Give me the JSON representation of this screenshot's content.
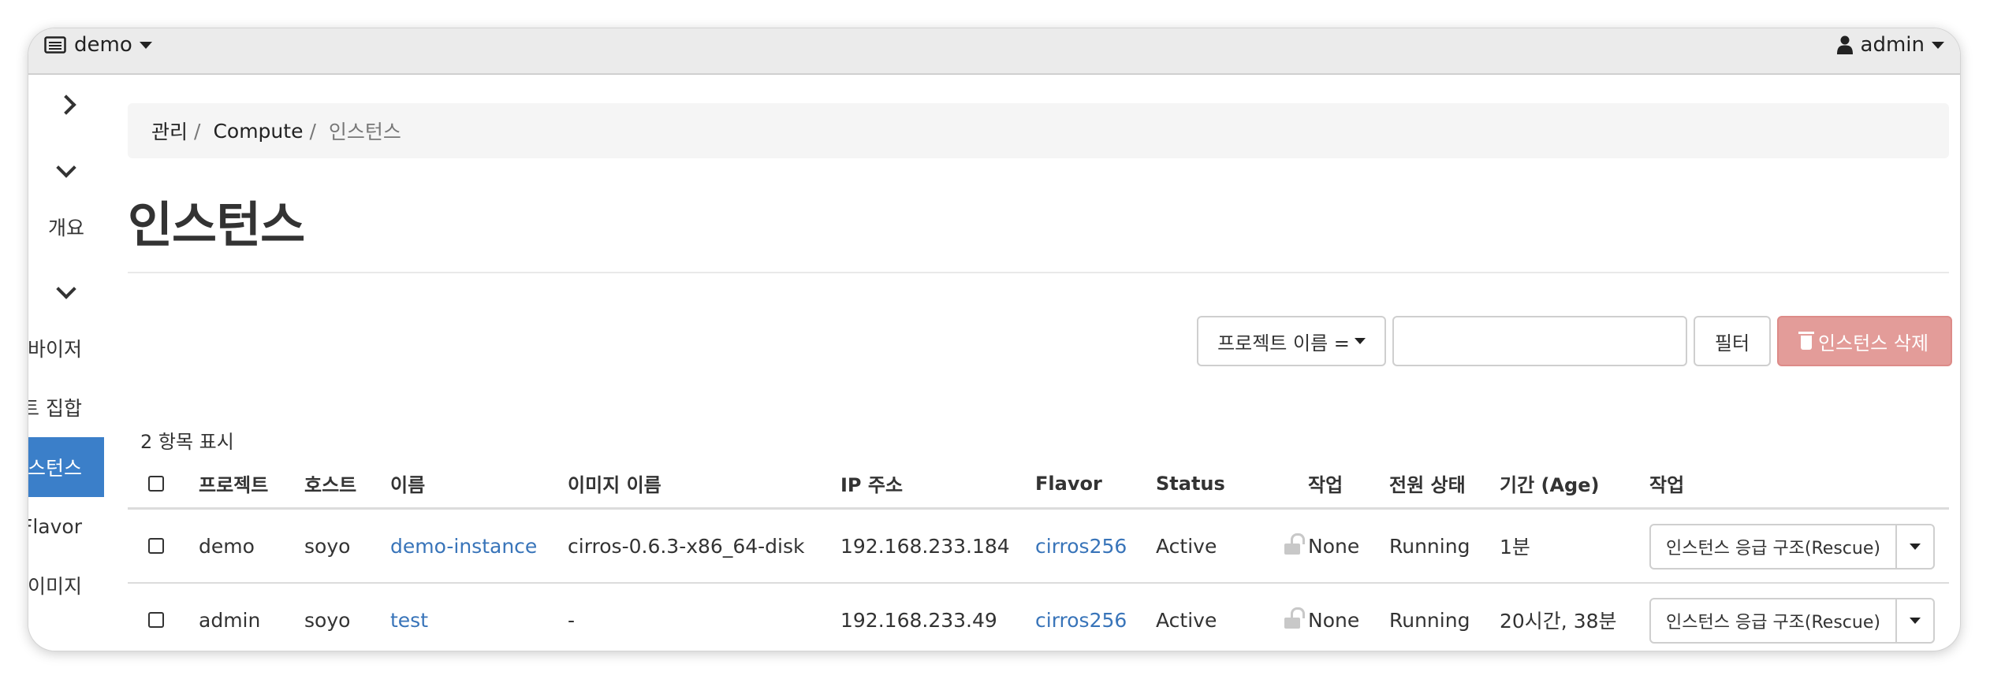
{
  "navbar": {
    "project": "demo",
    "user": "admin"
  },
  "sidebar": {
    "items": [
      {
        "label": "개요"
      },
      {
        "label": "바이저"
      },
      {
        "label": "트 집합"
      },
      {
        "label": "스턴스"
      },
      {
        "label": "Flavor"
      },
      {
        "label": "이미지"
      }
    ]
  },
  "breadcrumb": {
    "items": [
      "관리",
      "Compute"
    ],
    "current": "인스턴스",
    "separator": "/"
  },
  "page": {
    "title": "인스턴스"
  },
  "toolbar": {
    "filter_field": "프로젝트 이름 =",
    "filter_value": "",
    "filter_button": "필터",
    "delete_button": "인스턴스 삭제"
  },
  "table": {
    "count_text": "2 항목 표시",
    "columns": [
      "프로젝트",
      "호스트",
      "이름",
      "이미지 이름",
      "IP 주소",
      "Flavor",
      "Status",
      "작업",
      "전원 상태",
      "기간 (Age)",
      "작업"
    ],
    "rows": [
      {
        "project": "demo",
        "host": "soyo",
        "name": "demo-instance",
        "image": "cirros-0.6.3-x86_64-disk",
        "ip": "192.168.233.184",
        "flavor": "cirros256",
        "status": "Active",
        "task": "None",
        "power": "Running",
        "age": "1분",
        "action": "인스턴스 응급 구조(Rescue)"
      },
      {
        "project": "admin",
        "host": "soyo",
        "name": "test",
        "image": "-",
        "ip": "192.168.233.49",
        "flavor": "cirros256",
        "status": "Active",
        "task": "None",
        "power": "Running",
        "age": "20시간, 38분",
        "action": "인스턴스 응급 구조(Rescue)"
      }
    ]
  },
  "colors": {
    "accent": "#3b7fc9",
    "link": "#3874b9",
    "danger_disabled": "#e39c99"
  },
  "icons": {
    "project_menu": "server-icon",
    "user_menu": "user-icon",
    "delete": "trash-icon",
    "lock": "unlock-icon"
  }
}
